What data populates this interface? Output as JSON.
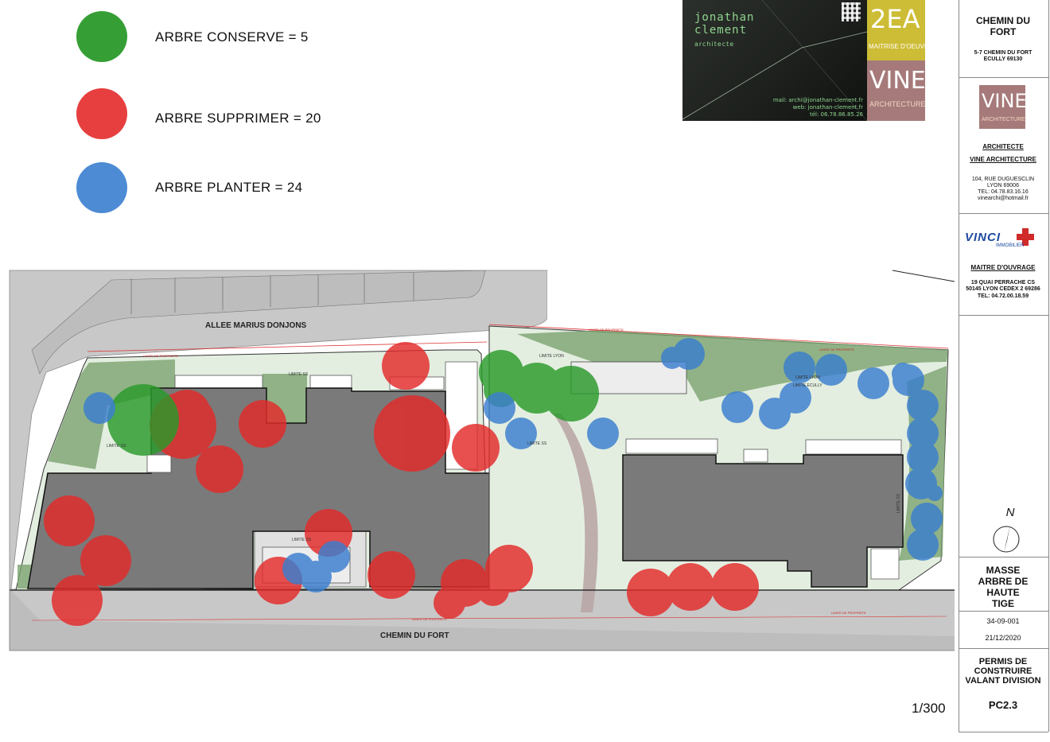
{
  "legend": {
    "conserve": {
      "label": "ARBRE CONSERVE = 5",
      "color": "#2a9a2a"
    },
    "supprimer": {
      "label": "ARBRE SUPPRIMER = 20",
      "color": "#e42a2a"
    },
    "planter": {
      "label": "ARBRE PLANTER = 24",
      "color": "#3a7ecf"
    }
  },
  "logos": {
    "jonathan": {
      "name": "jonathan\nclement",
      "sub": "architecte",
      "mail": "mail: archi@jonathan-clement.fr",
      "web": "web: jonathan-clement.fr",
      "tel": "tél: 06.78.86.85.26"
    },
    "twoea": {
      "big": "2EA",
      "small": "MAITRISE D'OEUVRE"
    },
    "vine": {
      "big": "VINE",
      "small": "ARCHITECTURE"
    }
  },
  "title_block": {
    "project": "CHEMIN DU FORT",
    "address": "5-7 CHEMIN DU FORT ECULLY 69130",
    "architect_heading": "ARCHITECTE",
    "architect_name": "VINE ARCHITECTURE",
    "architect_address": "104, RUE DUGUESCLIN LYON 69006",
    "architect_tel": "TEL: 04.78.83.16.16",
    "architect_mail": "vinearchi@hotmail.fr",
    "vinci_name": "VINCI",
    "vinci_sub": "IMMOBILIER",
    "owner_heading": "MAITRE D'OUVRAGE",
    "owner_address": "19 QUAI PERRACHE CS 50145 LYON CEDEX 2 69286",
    "owner_tel": "TEL: 04.72.00.18.59",
    "north": "N",
    "sheet_title": "MASSE ARBRE DE HAUTE TIGE",
    "sheet_code": "34-09-001",
    "date": "21/12/2020",
    "permit": "PERMIS DE CONSTRUIRE VALANT DIVISION",
    "sheet_number": "PC2.3"
  },
  "scale": "1/300",
  "map": {
    "street_top": "ALLEE MARIUS DONJONS",
    "street_bottom": "CHEMIN DU FORT",
    "limite_ss": "LIMITE SS",
    "limite_lyon": "LIMITE LYON",
    "limite_ecully": "LIMITE ECULLY",
    "limite_propriete": "LIMITE DE PROPRIETE"
  }
}
